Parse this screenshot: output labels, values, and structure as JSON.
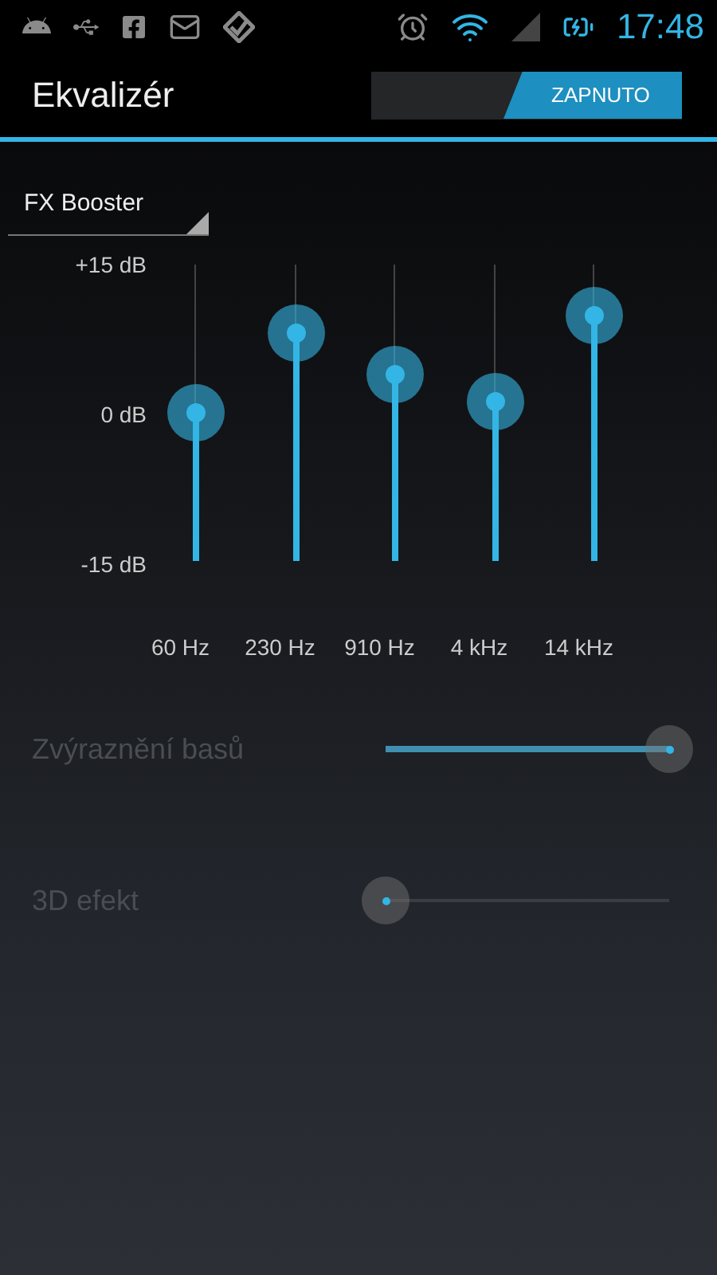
{
  "status_bar": {
    "time": "17:48"
  },
  "action_bar": {
    "title": "Ekvalizér",
    "switch": {
      "label": "ZAPNUTO",
      "on": true
    }
  },
  "preset": {
    "value": "FX Booster"
  },
  "equalizer": {
    "scale": [
      "+15 dB",
      "0 dB",
      "-15 dB"
    ],
    "bands": [
      {
        "label": "60 Hz",
        "level": 0.5
      },
      {
        "label": "230 Hz",
        "level": 0.77
      },
      {
        "label": "910 Hz",
        "level": 0.63
      },
      {
        "label": "4 kHz",
        "level": 0.54
      },
      {
        "label": "14 kHz",
        "level": 0.83
      }
    ]
  },
  "effects": [
    {
      "label": "Zvýraznění basů",
      "level": 1,
      "disabled": true
    },
    {
      "label": "3D efekt",
      "level": 0,
      "disabled": true
    }
  ]
}
